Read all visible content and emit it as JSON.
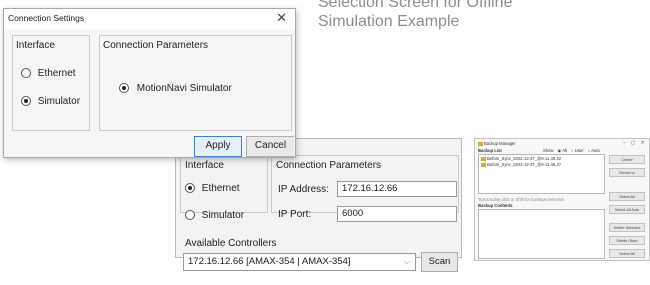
{
  "caption": {
    "line1": "Selection Screen for Offline",
    "line2": "Simulation Example"
  },
  "dialog": {
    "title": "Connection Settings",
    "close_glyph": "✕",
    "interface_label": "Interface",
    "ethernet_label": "Ethernet",
    "simulator_label": "Simulator",
    "selected_interface": "Simulator",
    "params_label": "Connection Parameters",
    "motionnavi_label": "MotionNavi Simulator",
    "apply_label": "Apply",
    "cancel_label": "Cancel"
  },
  "behind_window": {
    "interface_label": "Interface",
    "ethernet_label": "Ethernet",
    "simulator_label": "Simulator",
    "selected_interface": "Ethernet",
    "params_label": "Connection Parameters",
    "ip_address_label": "IP Address:",
    "ip_address_value": "172.16.12.66",
    "ip_port_label": "IP Port:",
    "ip_port_value": "6000",
    "controllers_label": "Available Controllers",
    "controller_value": "172.16.12.66 [AMAX-354 | AMAX-354]",
    "scan_label": "Scan"
  },
  "backup_manager": {
    "title": "Backup Manager",
    "window_controls": [
      "–",
      "▢",
      "✕"
    ],
    "backup_list_label": "Backup List",
    "show_label": "Show",
    "show_options": [
      "All",
      "User",
      "Auto"
    ],
    "selected_show": "All",
    "items": [
      "Before_Sync_2022-12-27_@9-11.49.42",
      "Before_Sync_2022-12-27_@9-11.49.37"
    ],
    "hint": "Tips:Double click or Shift for backups selection",
    "contents_label": "Backup Contents",
    "buttons": [
      "Create",
      "Revert to",
      "Select All",
      "Select All Auto",
      "Delete Selected",
      "Delete Older",
      "Select All"
    ]
  }
}
